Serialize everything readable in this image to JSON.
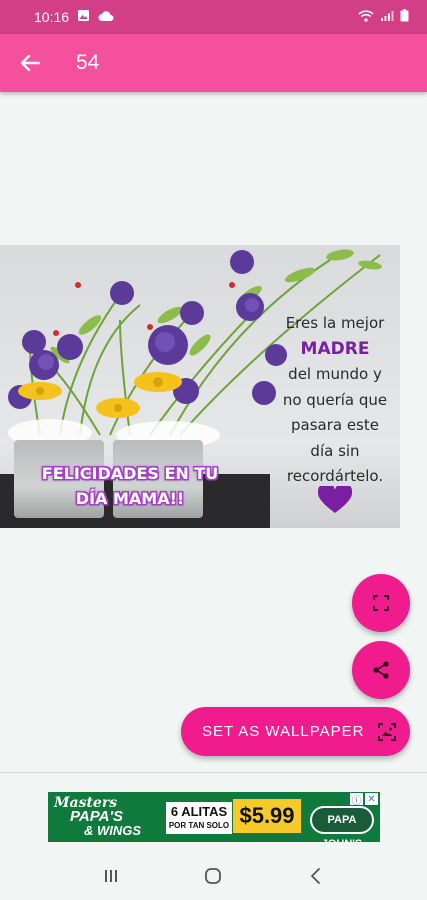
{
  "status_bar": {
    "time": "10:16"
  },
  "app_bar": {
    "title": "54"
  },
  "image": {
    "message_lines": [
      "Eres la mejor",
      "MADRE",
      "del mundo y",
      "no quería que",
      "pasara este",
      "día sin",
      "recordártelo."
    ],
    "greeting_lines": [
      "FELICIDADES EN TU",
      "DÍA MAMA!!"
    ]
  },
  "actions": {
    "set_wallpaper_label": "SET AS WALLPAPER"
  },
  "ad": {
    "masters": "Masters",
    "papas": "PAPA'S",
    "wings": "& WINGS",
    "alitas": "6 ALITAS",
    "por_tan_solo": "POR TAN SOLO",
    "price": "$5.99",
    "brand": "PAPA JOHN'S"
  },
  "colors": {
    "status_bar": "#d23f87",
    "app_bar": "#f4509d",
    "accent": "#f01b8d"
  }
}
